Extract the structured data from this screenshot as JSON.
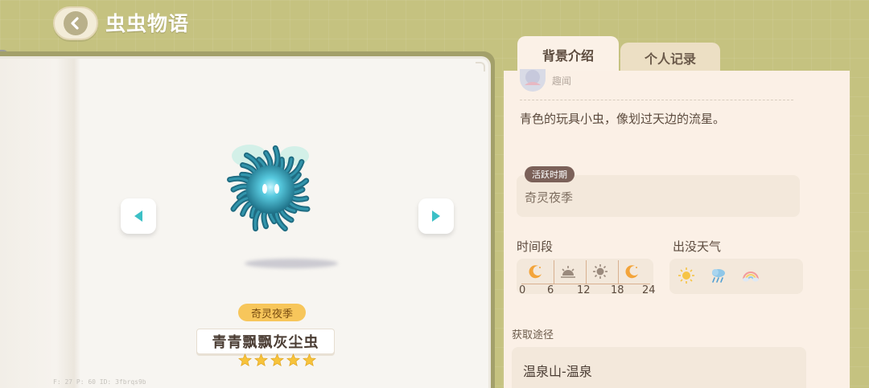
{
  "header": {
    "title": "虫虫物语"
  },
  "book": {
    "season_tag": "奇灵夜季",
    "bug_name": "青青飘飘灰尘虫",
    "rating": 5,
    "debug_text": "F: 27   P: 60   ID: 3fbrqs9b"
  },
  "tabs": [
    {
      "label": "背景介绍",
      "active": true
    },
    {
      "label": "个人记录",
      "active": false
    }
  ],
  "panel": {
    "avatar_label": "趣闻",
    "description": "青色的玩具小虫，像划过天边的流星。",
    "active_period": {
      "tag": "活跃时期",
      "value": "奇灵夜季"
    },
    "time_section": {
      "label": "时间段",
      "ticks": [
        "0",
        "6",
        "12",
        "18",
        "24"
      ],
      "icons": [
        "moon-icon",
        "sunrise-icon",
        "sun-icon",
        "moon-icon"
      ]
    },
    "weather_section": {
      "label": "出没天气",
      "icons": [
        "sunny-icon",
        "rain-icon",
        "rainbow-icon"
      ]
    },
    "obtain": {
      "label": "获取途径",
      "value": "温泉山-温泉"
    }
  },
  "colors": {
    "background": "#c5c280",
    "accent_yellow": "#f7c65b",
    "bug_teal": "#2aa3b8"
  }
}
